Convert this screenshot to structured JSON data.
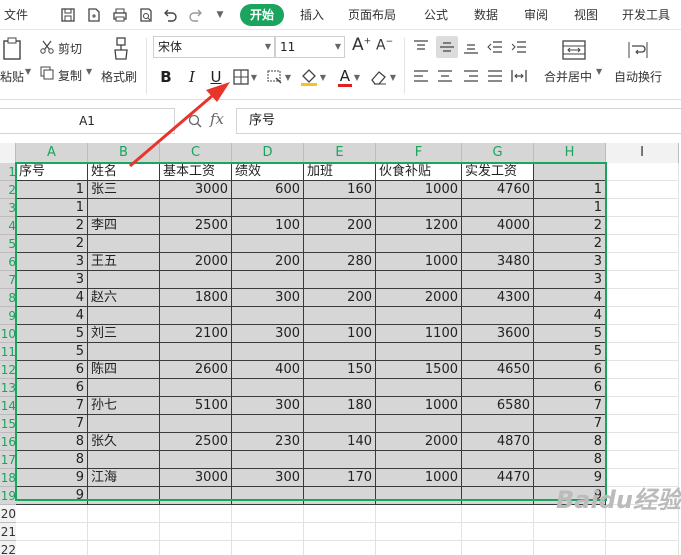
{
  "menu": {
    "file": "文件",
    "tabs": [
      "开始",
      "插入",
      "页面布局",
      "公式",
      "数据",
      "审阅",
      "视图",
      "开发工具"
    ]
  },
  "ribbon": {
    "paste": "粘贴",
    "cut": "剪切",
    "copy": "复制",
    "format_painter": "格式刷",
    "font_name": "宋体",
    "font_size": "11",
    "bold": "B",
    "italic": "I",
    "underline": "U",
    "font_color_letter": "A",
    "grow_font": "A",
    "shrink_font": "A",
    "merge_center": "合并居中",
    "wrap_text": "自动换行"
  },
  "formula_bar": {
    "cell_ref": "A1",
    "fx": "fx",
    "content": "序号"
  },
  "sheet": {
    "columns": [
      "A",
      "B",
      "C",
      "D",
      "E",
      "F",
      "G",
      "H",
      "I"
    ],
    "row_numbers": [
      "1",
      "2",
      "3",
      "4",
      "5",
      "6",
      "7",
      "8",
      "9",
      "10",
      "11",
      "12",
      "13",
      "14",
      "15",
      "16",
      "17",
      "18",
      "19",
      "20",
      "21",
      "22"
    ],
    "header": [
      "序号",
      "姓名",
      "基本工资",
      "绩效",
      "加班",
      "伙食补贴",
      "实发工资"
    ],
    "rows": [
      [
        "1",
        "张三",
        "3000",
        "600",
        "160",
        "1000",
        "4760",
        "1"
      ],
      [
        "1",
        "",
        "",
        "",
        "",
        "",
        "",
        "1"
      ],
      [
        "2",
        "李四",
        "2500",
        "100",
        "200",
        "1200",
        "4000",
        "2"
      ],
      [
        "2",
        "",
        "",
        "",
        "",
        "",
        "",
        "2"
      ],
      [
        "3",
        "王五",
        "2000",
        "200",
        "280",
        "1000",
        "3480",
        "3"
      ],
      [
        "3",
        "",
        "",
        "",
        "",
        "",
        "",
        "3"
      ],
      [
        "4",
        "赵六",
        "1800",
        "300",
        "200",
        "2000",
        "4300",
        "4"
      ],
      [
        "4",
        "",
        "",
        "",
        "",
        "",
        "",
        "4"
      ],
      [
        "5",
        "刘三",
        "2100",
        "300",
        "100",
        "1100",
        "3600",
        "5"
      ],
      [
        "5",
        "",
        "",
        "",
        "",
        "",
        "",
        "5"
      ],
      [
        "6",
        "陈四",
        "2600",
        "400",
        "150",
        "1500",
        "4650",
        "6"
      ],
      [
        "6",
        "",
        "",
        "",
        "",
        "",
        "",
        "6"
      ],
      [
        "7",
        "孙七",
        "5100",
        "300",
        "180",
        "1000",
        "6580",
        "7"
      ],
      [
        "7",
        "",
        "",
        "",
        "",
        "",
        "",
        "7"
      ],
      [
        "8",
        "张久",
        "2500",
        "230",
        "140",
        "2000",
        "4870",
        "8"
      ],
      [
        "8",
        "",
        "",
        "",
        "",
        "",
        "",
        "8"
      ],
      [
        "9",
        "江海",
        "3000",
        "300",
        "170",
        "1000",
        "4470",
        "9"
      ],
      [
        "9",
        "",
        "",
        "",
        "",
        "",
        "",
        "9"
      ]
    ]
  },
  "watermark": "Baidu经验",
  "colors": {
    "accent": "#1aa45e",
    "selection": "#d6d6d6",
    "arrow": "#e8342a"
  }
}
